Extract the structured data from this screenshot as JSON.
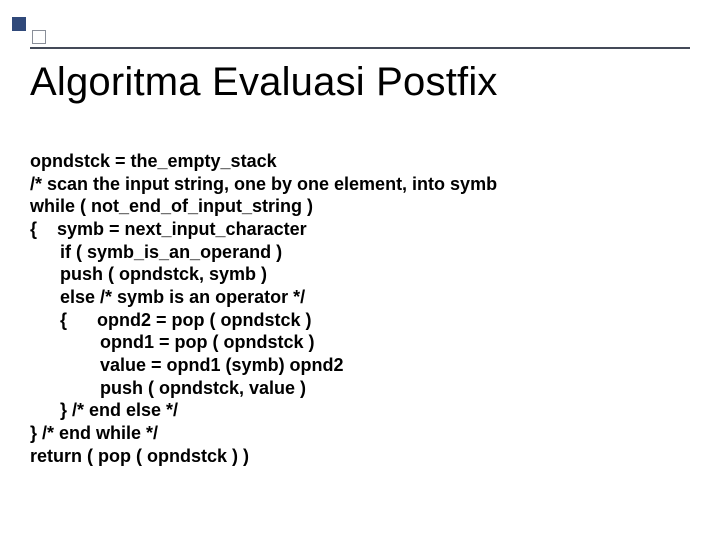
{
  "title": "Algoritma Evaluasi Postfix",
  "lines": {
    "l0": "opndstck = the_empty_stack",
    "l1": "/* scan the input string, one by one element, into symb",
    "l2": "while ( not_end_of_input_string )",
    "l3": "{    symb = next_input_character",
    "l4": "      if ( symb_is_an_operand )",
    "l5": "      push ( opndstck, symb )",
    "l6": "      else /* symb is an operator */",
    "l7": "      {      opnd2 = pop ( opndstck )",
    "l8": "              opnd1 = pop ( opndstck )",
    "l9": "              value = opnd1 (symb) opnd2",
    "l10": "              push ( opndstck, value )",
    "l11": "      } /* end else */",
    "l12": "} /* end while */",
    "l13": "return ( pop ( opndstck ) )"
  }
}
